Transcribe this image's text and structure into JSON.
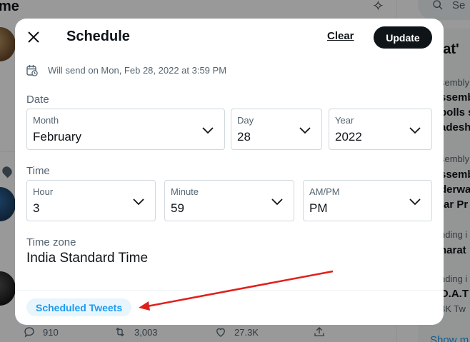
{
  "background": {
    "title_partial": "me",
    "tweet_actions": {
      "reply_count": "910",
      "retweet_count": "3,003",
      "like_count": "27.3K"
    },
    "search_placeholder_partial": "Se",
    "trends": {
      "header_partial": "hat'",
      "items": [
        {
          "context": "sembly",
          "lines": [
            "ssemb",
            "polls s",
            "adesh"
          ]
        },
        {
          "context": "sembly",
          "lines": [
            "ssemb",
            "derwa",
            "tar Pr"
          ]
        },
        {
          "context": "nding i",
          "lines": [
            "harat"
          ]
        },
        {
          "context": "nding i",
          "lines": [
            "O.A.T",
            "3K Tw"
          ]
        }
      ],
      "show_more_partial": "Show m"
    }
  },
  "modal": {
    "title": "Schedule",
    "clear_label": "Clear",
    "update_label": "Update",
    "will_send_text": "Will send on Mon, Feb 28, 2022 at 3:59 PM",
    "date_label": "Date",
    "date": {
      "month": {
        "label": "Month",
        "value": "February"
      },
      "day": {
        "label": "Day",
        "value": "28"
      },
      "year": {
        "label": "Year",
        "value": "2022"
      }
    },
    "time_label": "Time",
    "time": {
      "hour": {
        "label": "Hour",
        "value": "3"
      },
      "minute": {
        "label": "Minute",
        "value": "59"
      },
      "ampm": {
        "label": "AM/PM",
        "value": "PM"
      }
    },
    "timezone_label": "Time zone",
    "timezone_value": "India Standard Time",
    "scheduled_tweets_label": "Scheduled Tweets"
  },
  "colors": {
    "accent": "#1d9bf0",
    "annotation_arrow": "#e0201b",
    "dark_button": "#0f1419"
  }
}
